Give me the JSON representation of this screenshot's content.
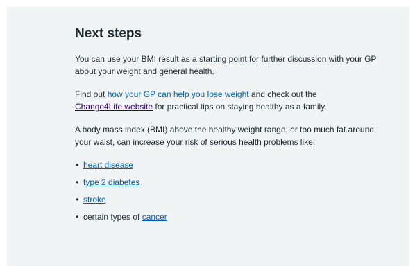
{
  "section": {
    "heading": "Next steps",
    "para1": "You can use your BMI result as a starting point for further discussion with your GP about your weight and general health.",
    "para2": {
      "before": "Find out ",
      "link1": "how your GP can help you lose weight",
      "middle": " and check out the ",
      "link2": "Change4Life website",
      "after": " for practical tips on staying healthy as a family."
    },
    "para3": "A body mass index (BMI) above the healthy weight range, or too much fat around your waist, can increase your risk of serious health problems like:",
    "bullet_glyph": "•",
    "list": [
      {
        "link": "heart disease"
      },
      {
        "link": "type 2 diabetes"
      },
      {
        "link": "stroke"
      },
      {
        "prefix": "certain types of ",
        "link": "cancer"
      }
    ]
  },
  "colors": {
    "panel_background": "#f0f4f5",
    "text": "#212b32",
    "link": "#005eb8",
    "visited_link": "#330072"
  }
}
